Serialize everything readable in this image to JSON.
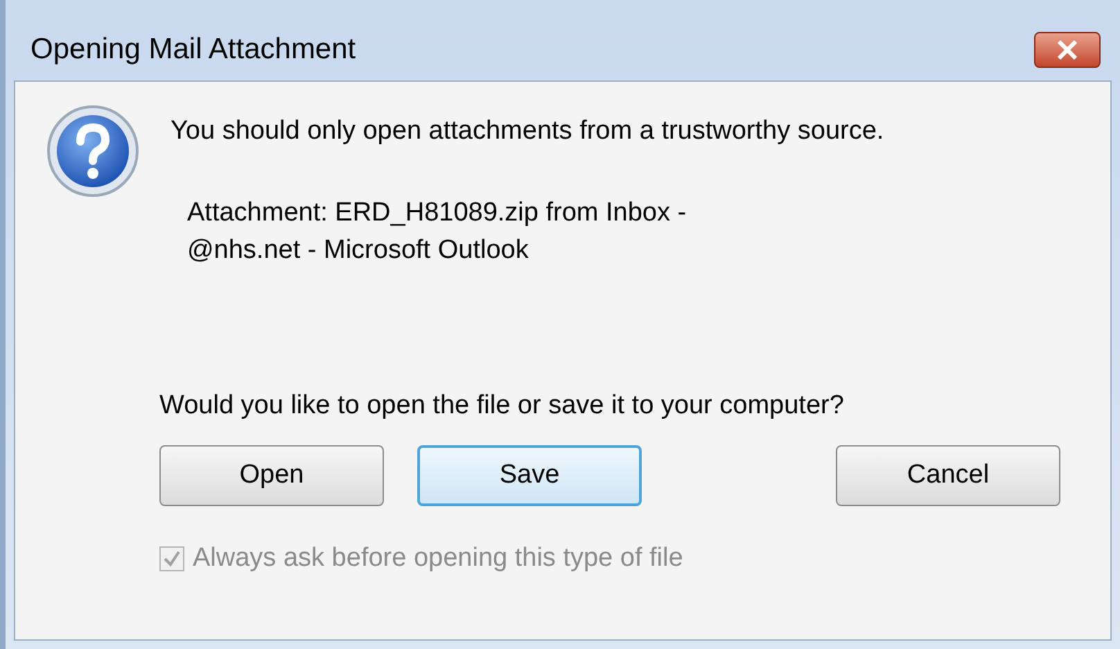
{
  "window": {
    "title": "Opening Mail Attachment"
  },
  "message": "You should only open attachments from a trustworthy source.",
  "details": [
    "Attachment: ERD_H81089.zip from Inbox -",
    "@nhs.net - Microsoft Outlook"
  ],
  "question": "Would you like to open the file or save it to your computer?",
  "buttons": [
    {
      "label": "Open",
      "focused": false
    },
    {
      "label": "Save",
      "focused": true
    },
    {
      "label": "Cancel",
      "focused": false
    }
  ],
  "checkbox": {
    "label": "Always ask before opening this type of file",
    "checked": true,
    "disabled": true
  }
}
